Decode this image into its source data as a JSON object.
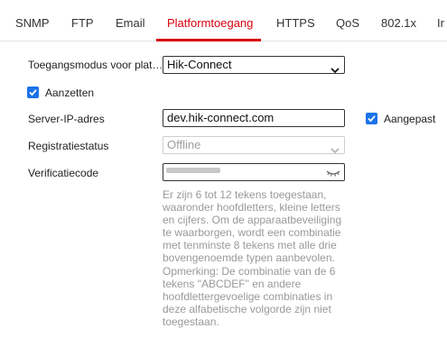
{
  "tabs": [
    {
      "label": "SNMP",
      "active": false
    },
    {
      "label": "FTP",
      "active": false
    },
    {
      "label": "Email",
      "active": false
    },
    {
      "label": "Platformtoegang",
      "active": true
    },
    {
      "label": "HTTPS",
      "active": false
    },
    {
      "label": "QoS",
      "active": false
    },
    {
      "label": "802.1x",
      "active": false
    },
    {
      "label": "Ir",
      "active": false
    }
  ],
  "form": {
    "access_mode": {
      "label": "Toegangsmodus voor plat…",
      "value": "Hik-Connect"
    },
    "enable": {
      "label": "Aanzetten",
      "checked": true
    },
    "server_ip": {
      "label": "Server-IP-adres",
      "value": "dev.hik-connect.com"
    },
    "custom": {
      "label": "Aangepast",
      "checked": true
    },
    "registration": {
      "label": "Registratiestatus",
      "value": "Offline"
    },
    "verification": {
      "label": "Verificatiecode",
      "masked": true
    },
    "hint": "Er zijn 6 tot 12 tekens toegestaan, waaronder hoofdletters, kleine letters en cijfers. Om de apparaatbeveiliging te waarborgen, wordt een combinatie met tenminste 8 tekens met alle drie bovengenoemde typen aanbevolen. Opmerking: De combinatie van de 6 tekens \"ABCDEF\" en andere hoofdlettergevoelige combinaties in deze alfabetische volgorde zijn niet toegestaan."
  },
  "colors": {
    "accent": "#d7000f",
    "checkbox": "#1a73e8",
    "hint_text": "#999999"
  },
  "icons": {
    "dropdown": "chevron-down-icon",
    "check": "check-icon",
    "password_toggle": "eye-closed-icon"
  }
}
